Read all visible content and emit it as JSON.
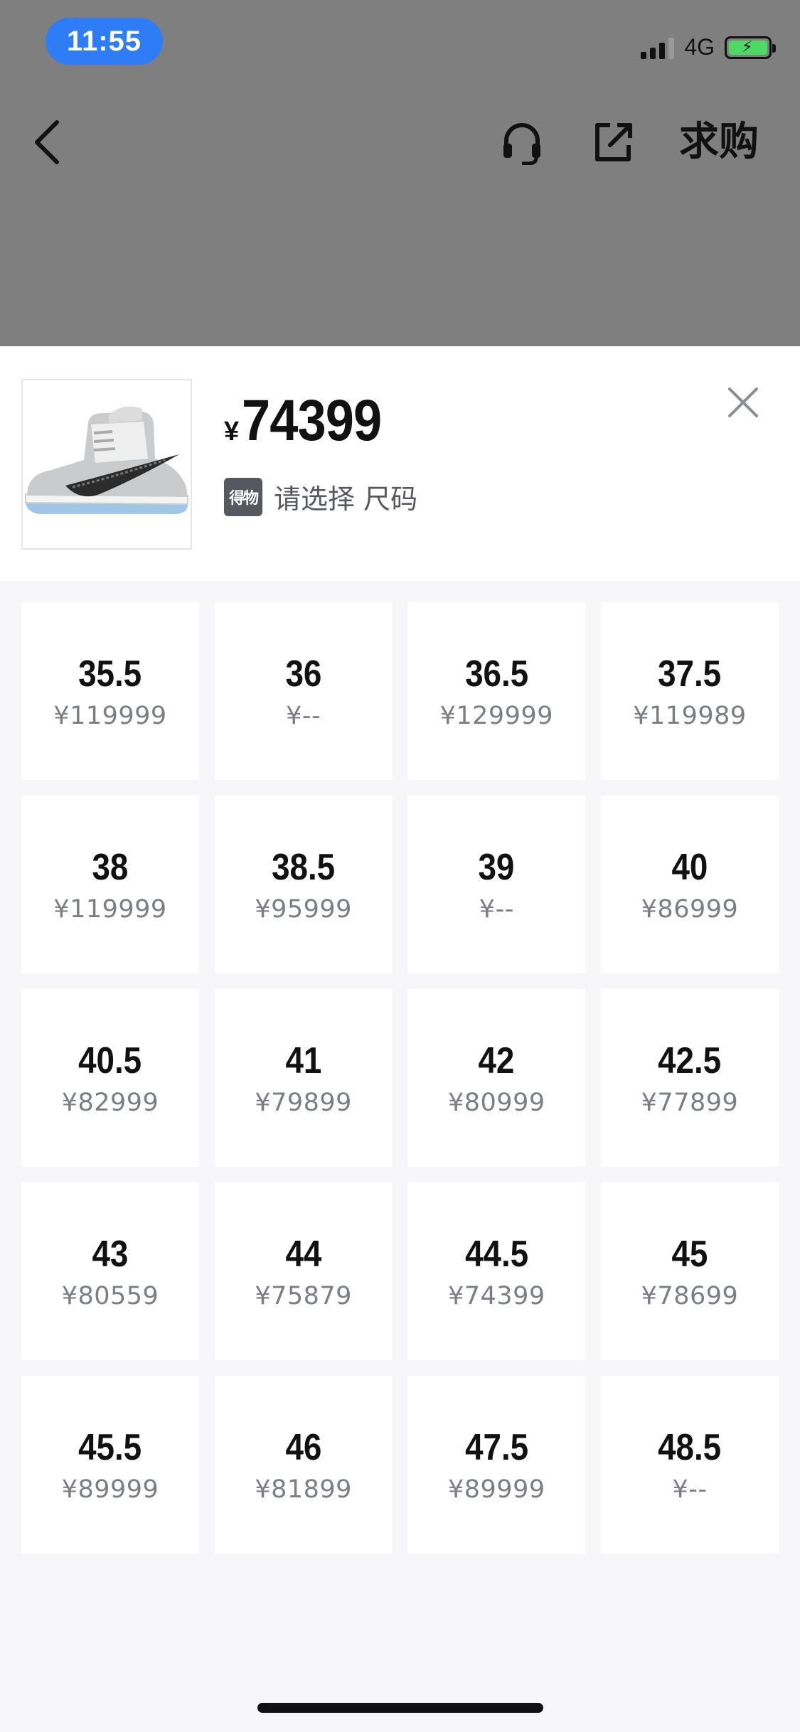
{
  "status_bar": {
    "time": "11:55",
    "network": "4G",
    "accent_color": "#2f7df6",
    "battery_color": "#4cd964"
  },
  "nav": {
    "back_icon": "chevron-left-icon",
    "support_icon": "headset-icon",
    "share_icon": "share-icon",
    "buy_label": "求购"
  },
  "product": {
    "price_symbol": "¥",
    "price": "74399",
    "badge_text": "得物",
    "select_prompt": "请选择 尺码",
    "close_icon": "close-icon"
  },
  "sizes": [
    {
      "size": "35.5",
      "price": "¥119999"
    },
    {
      "size": "36",
      "price": "¥--"
    },
    {
      "size": "36.5",
      "price": "¥129999"
    },
    {
      "size": "37.5",
      "price": "¥119989"
    },
    {
      "size": "38",
      "price": "¥119999"
    },
    {
      "size": "38.5",
      "price": "¥95999"
    },
    {
      "size": "39",
      "price": "¥--"
    },
    {
      "size": "40",
      "price": "¥86999"
    },
    {
      "size": "40.5",
      "price": "¥82999"
    },
    {
      "size": "41",
      "price": "¥79899"
    },
    {
      "size": "42",
      "price": "¥80999"
    },
    {
      "size": "42.5",
      "price": "¥77899"
    },
    {
      "size": "43",
      "price": "¥80559"
    },
    {
      "size": "44",
      "price": "¥75879"
    },
    {
      "size": "44.5",
      "price": "¥74399"
    },
    {
      "size": "45",
      "price": "¥78699"
    },
    {
      "size": "45.5",
      "price": "¥89999"
    },
    {
      "size": "46",
      "price": "¥81899"
    },
    {
      "size": "47.5",
      "price": "¥89999"
    },
    {
      "size": "48.5",
      "price": "¥--"
    }
  ]
}
